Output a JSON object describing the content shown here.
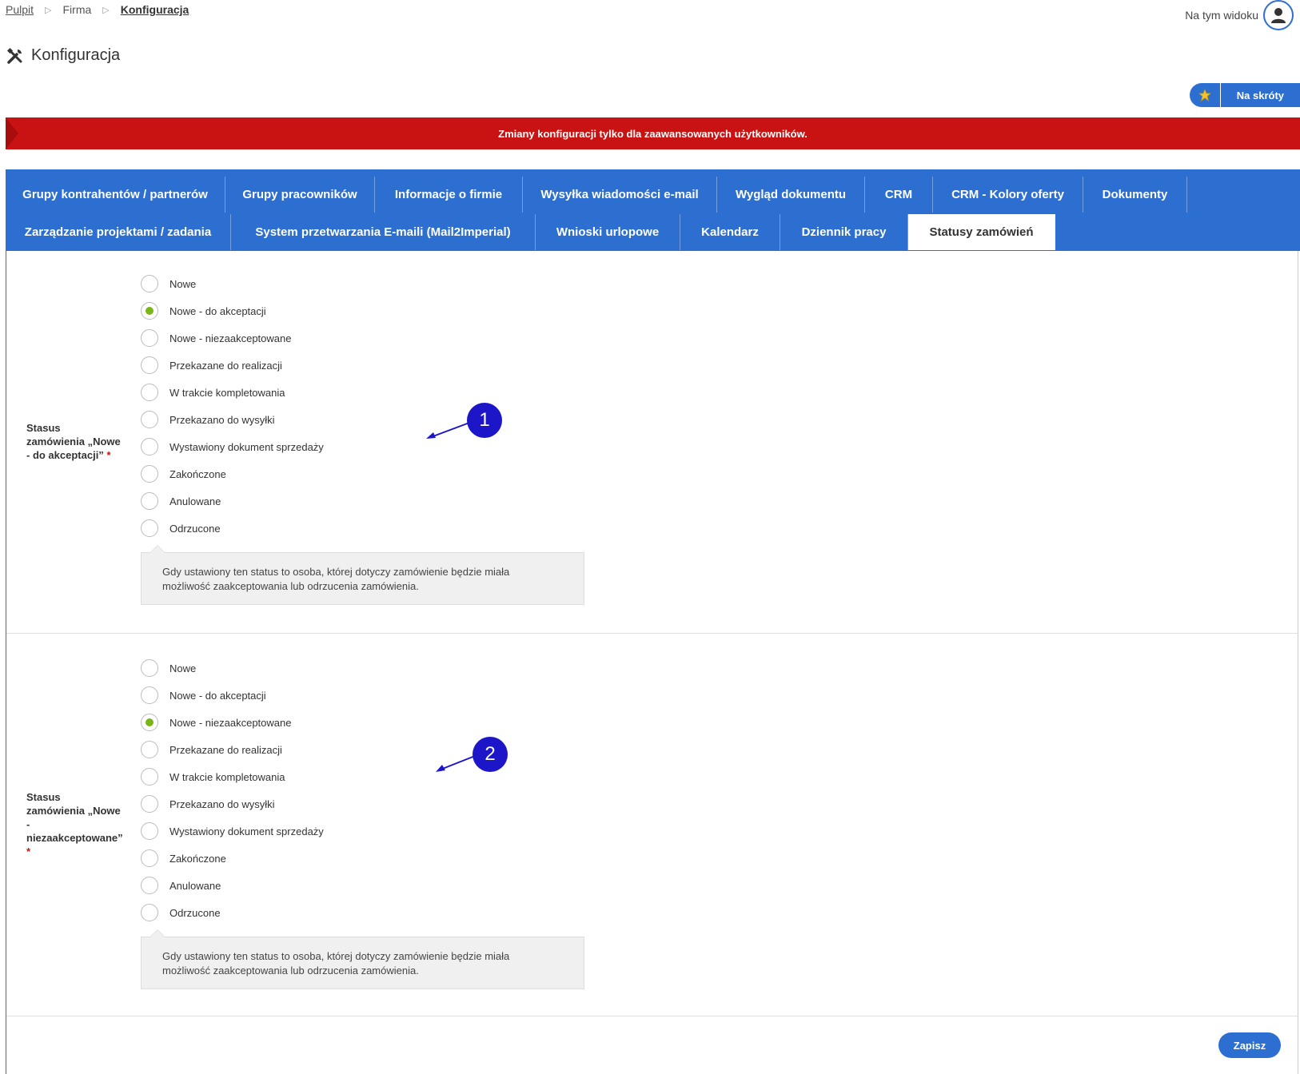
{
  "breadcrumb": {
    "items": [
      "Pulpit",
      "Firma",
      "Konfiguracja"
    ]
  },
  "header": {
    "view_label": "Na tym widoku",
    "title": "Konfiguracja",
    "shortcut_label": "Na skróty"
  },
  "warning": {
    "text": "Zmiany konfiguracji tylko dla zaawansowanych użytkowników."
  },
  "tabs": {
    "row1": [
      "Grupy kontrahentów / partnerów",
      "Grupy pracowników",
      "Informacje o firmie",
      "Wysyłka wiadomości e-mail",
      "Wygląd dokumentu",
      "CRM",
      "CRM - Kolory oferty",
      "Dokumenty"
    ],
    "row2": [
      "Zarządzanie projektami / zadania",
      "System przetwarzania E-maili (Mail2Imperial)",
      "Wnioski urlopowe",
      "Kalendarz",
      "Dziennik pracy",
      "Statusy zamówień"
    ],
    "active": "Statusy zamówień"
  },
  "statuses": [
    "Nowe",
    "Nowe - do akceptacji",
    "Nowe - niezaakceptowane",
    "Przekazane do realizacji",
    "W trakcie kompletowania",
    "Przekazano do wysyłki",
    "Wystawiony dokument sprzedaży",
    "Zakończone",
    "Anulowane",
    "Odrzucone"
  ],
  "sections": [
    {
      "label_lines": [
        "Stasus",
        "zamówienia „Nowe",
        "- do akceptacji”"
      ],
      "required": "*",
      "selected": "Nowe - do akceptacji",
      "hint_lines": [
        "Gdy ustawiony ten status to osoba, której dotyczy zamówienie będzie miała",
        "możliwość zaakceptowania lub odrzucenia zamówienia."
      ],
      "marker": "1"
    },
    {
      "label_lines": [
        "Stasus",
        "zamówienia „Nowe",
        "-",
        "niezaakceptowane”"
      ],
      "required": "*",
      "selected": "Nowe - niezaakceptowane",
      "hint_lines": [
        "Gdy ustawiony ten status to osoba, której dotyczy zamówienie będzie miała",
        "możliwość zaakceptowania lub odrzucenia zamówienia."
      ],
      "marker": "2"
    }
  ],
  "footer": {
    "save_label": "Zapisz"
  },
  "colors": {
    "primary": "#2d6fd1",
    "warning": "#c91313",
    "radio_checked": "#7cb518",
    "marker": "#1c16c8"
  }
}
